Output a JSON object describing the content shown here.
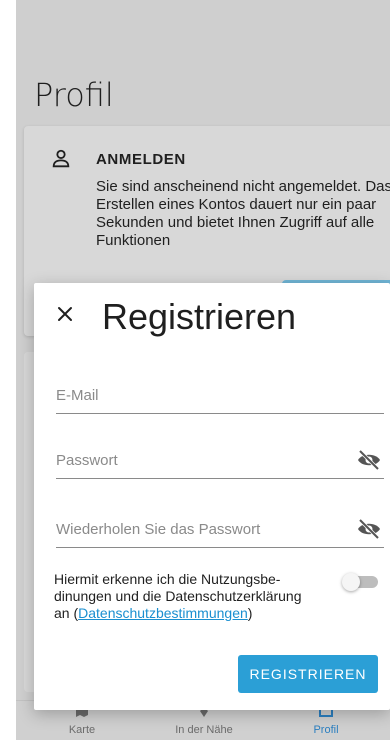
{
  "page": {
    "title": "Profil"
  },
  "login_card": {
    "heading": "ANMELDEN",
    "text": "Sie sind anscheinend nicht angemeldet. Das Erstellen eines Kontos dauert nur ein paar Sekunden und bietet Ihnen Zugriff auf alle Funktionen",
    "icon": "person-icon"
  },
  "bottom_nav": {
    "items": [
      {
        "label": "Karte",
        "icon": "map-icon"
      },
      {
        "label": "In der Nähe",
        "icon": "location-icon"
      },
      {
        "label": "Profil",
        "icon": "profile-icon",
        "active": true
      }
    ]
  },
  "modal": {
    "title": "Registrieren",
    "close_icon": "close-icon",
    "fields": {
      "email": {
        "placeholder": "E-Mail",
        "value": ""
      },
      "password": {
        "placeholder": "Passwort",
        "value": ""
      },
      "password_repeat": {
        "placeholder": "Wiederholen Sie das Passwort",
        "value": ""
      }
    },
    "consent": {
      "text": "Hiermit erkenne ich die Nutzungsbe-dinungen und die Datenschutzerklärung an (",
      "link": "Datenschutzbestimmungen",
      "suffix": ")",
      "toggle_on": false
    },
    "register_label": "REGISTRIEREN"
  },
  "colors": {
    "accent": "#2b9fd6",
    "link": "#1a8fd0",
    "overlay": "#cfcfcf"
  }
}
